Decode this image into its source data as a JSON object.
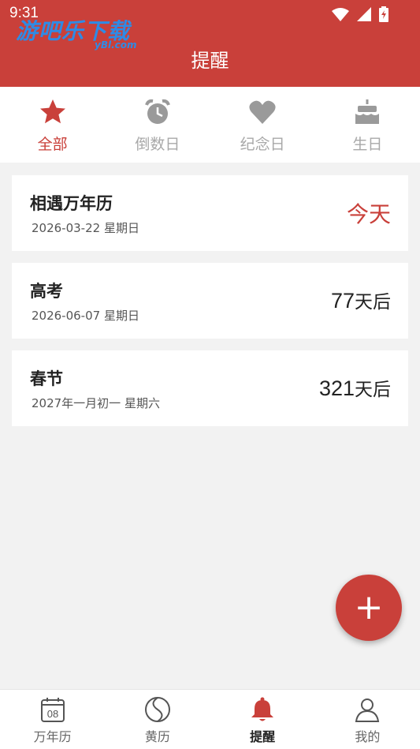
{
  "status_bar": {
    "time": "9:31"
  },
  "watermark": {
    "text": "游吧乐下载",
    "sub": "yBl.com"
  },
  "header": {
    "title": "提醒"
  },
  "tabs": [
    {
      "label": "全部",
      "icon": "star-icon",
      "active": true
    },
    {
      "label": "倒数日",
      "icon": "alarm-clock-icon",
      "active": false
    },
    {
      "label": "纪念日",
      "icon": "heart-icon",
      "active": false
    },
    {
      "label": "生日",
      "icon": "cake-icon",
      "active": false
    }
  ],
  "reminders": [
    {
      "title": "相遇万年历",
      "date": "2026-03-22 星期日",
      "status": "今天"
    },
    {
      "title": "高考",
      "date": "2026-06-07 星期日",
      "days": "77",
      "unit": "天后"
    },
    {
      "title": "春节",
      "date": "2027年一月初一 星期六",
      "days": "321",
      "unit": "天后"
    }
  ],
  "fab": {
    "label": "+"
  },
  "bottom_nav": [
    {
      "label": "万年历",
      "icon": "calendar-icon",
      "icon_text": "08",
      "active": false
    },
    {
      "label": "黄历",
      "icon": "yin-yang-icon",
      "active": false
    },
    {
      "label": "提醒",
      "icon": "bell-icon",
      "active": true
    },
    {
      "label": "我的",
      "icon": "person-icon",
      "active": false
    }
  ],
  "colors": {
    "primary": "#c9403a",
    "inactive": "#a8a8a8",
    "background": "#f2f2f2"
  }
}
